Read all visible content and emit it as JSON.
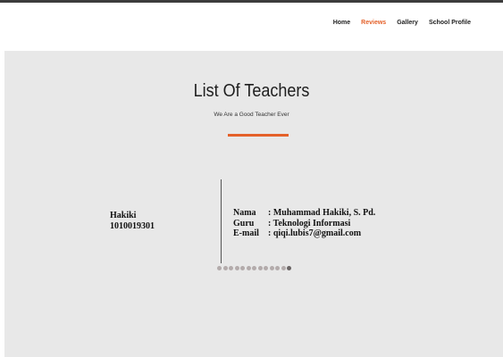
{
  "nav": {
    "items": [
      {
        "label": "Home",
        "active": false
      },
      {
        "label": "Reviews",
        "active": true
      },
      {
        "label": "Gallery",
        "active": false
      },
      {
        "label": "School Profile",
        "active": false
      }
    ]
  },
  "section": {
    "title": "List Of Teachers",
    "subtitle": "We Are a Good Teacher Ever"
  },
  "teacher": {
    "short_name": "Hakiki",
    "id_number": "1010019301",
    "fields": [
      {
        "label": "Nama",
        "value": ": Muhammad Hakiki, S. Pd."
      },
      {
        "label": "Guru",
        "value": ": Teknologi Informasi"
      },
      {
        "label": "E-mail",
        "value": ": qiqi.lubis7@gmail.com"
      }
    ]
  },
  "carousel": {
    "total": 13,
    "active_index": 12
  },
  "colors": {
    "accent": "#e4612a",
    "section_bg": "#e8e8e8",
    "dot": "#b3abab",
    "dot_active": "#6a6464"
  }
}
